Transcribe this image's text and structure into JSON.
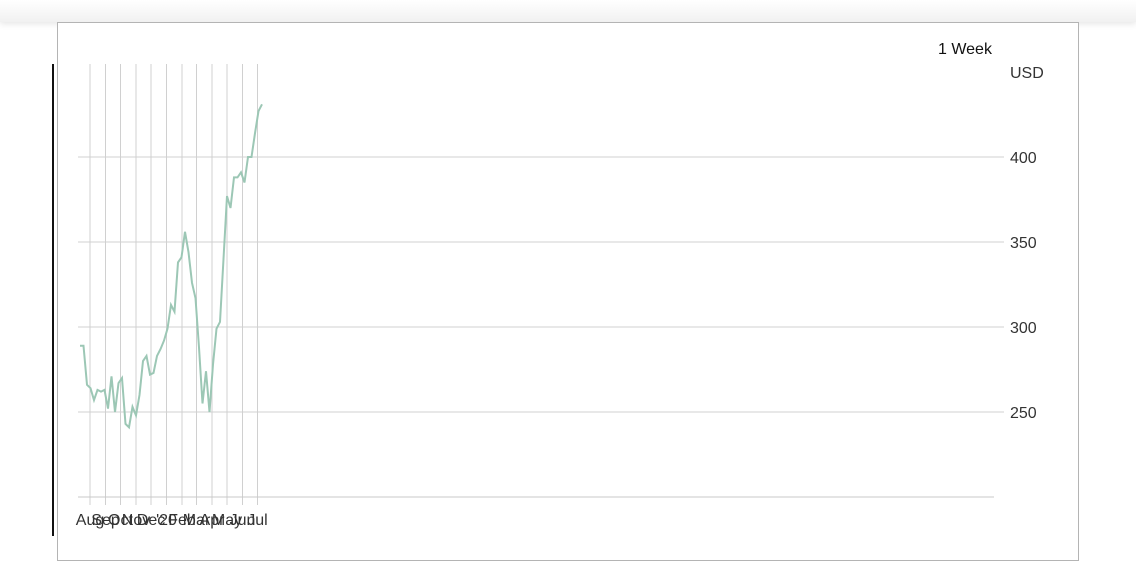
{
  "period_label": "1 Week",
  "chart_data": {
    "type": "line",
    "title": "",
    "xlabel": "",
    "ylabel": "USD",
    "x_tick_labels": [
      "Aug",
      "Sep",
      "Oct",
      "Nov",
      "Dec",
      "'20",
      "Feb",
      "Mar",
      "Apr",
      "May",
      "Jun",
      "Jul"
    ],
    "y_tick_labels": [
      "250",
      "300",
      "350",
      "400"
    ],
    "ylim": [
      200,
      430
    ],
    "grid": true,
    "line_color": "#9cc7b5",
    "grid_color": "#d0d0d0",
    "series": [
      {
        "x": [
          "2019-07-12",
          "2019-07-19",
          "2019-07-26",
          "2019-08-02",
          "2019-08-09",
          "2019-08-16",
          "2019-08-23",
          "2019-08-30",
          "2019-09-06",
          "2019-09-13",
          "2019-09-20",
          "2019-09-27",
          "2019-10-04",
          "2019-10-11",
          "2019-10-18",
          "2019-10-25",
          "2019-11-01",
          "2019-11-08",
          "2019-11-15",
          "2019-11-22",
          "2019-11-29",
          "2019-12-06",
          "2019-12-13",
          "2019-12-20",
          "2019-12-27",
          "2020-01-03",
          "2020-01-10",
          "2020-01-17",
          "2020-01-24",
          "2020-01-31",
          "2020-02-07",
          "2020-02-14",
          "2020-02-21",
          "2020-02-28",
          "2020-03-06",
          "2020-03-13",
          "2020-03-20",
          "2020-03-27",
          "2020-04-03",
          "2020-04-10",
          "2020-04-17",
          "2020-04-24",
          "2020-05-01",
          "2020-05-08",
          "2020-05-15",
          "2020-05-22",
          "2020-05-29",
          "2020-06-05",
          "2020-06-12",
          "2020-06-19",
          "2020-06-26",
          "2020-07-03",
          "2020-07-10"
        ],
        "values": [
          289,
          289,
          266,
          264,
          257,
          263,
          262,
          263,
          252,
          271,
          250,
          267,
          270,
          243,
          241,
          253,
          248,
          260,
          280,
          283,
          272,
          273,
          283,
          287,
          292,
          299,
          313,
          309,
          338,
          341,
          356,
          344,
          326,
          317,
          288,
          255,
          274,
          250,
          278,
          299,
          303,
          340,
          377,
          370,
          388,
          388,
          391,
          385,
          400,
          400,
          414,
          427,
          431
        ]
      }
    ]
  }
}
